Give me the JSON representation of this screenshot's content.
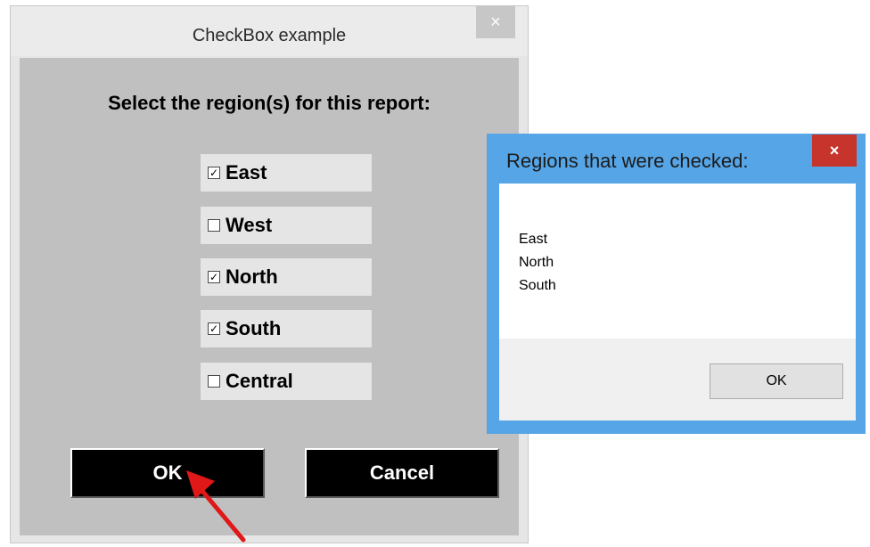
{
  "checkbox_dialog": {
    "title": "CheckBox example",
    "close_label": "×",
    "prompt": "Select the region(s) for this report:",
    "checkboxes": [
      {
        "label": "East",
        "checked": true
      },
      {
        "label": "West",
        "checked": false
      },
      {
        "label": "North",
        "checked": true
      },
      {
        "label": "South",
        "checked": true
      },
      {
        "label": "Central",
        "checked": false
      }
    ],
    "check_mark": "✓",
    "ok_label": "OK",
    "cancel_label": "Cancel"
  },
  "message_box": {
    "title": "Regions that were checked:",
    "close_label": "×",
    "lines": [
      "East",
      "North",
      "South"
    ],
    "ok_label": "OK"
  },
  "colors": {
    "dialog_client": "#c0c0c0",
    "message_border": "#56a5e6",
    "close_red": "#c7342b",
    "annotation_arrow": "#e01818"
  }
}
